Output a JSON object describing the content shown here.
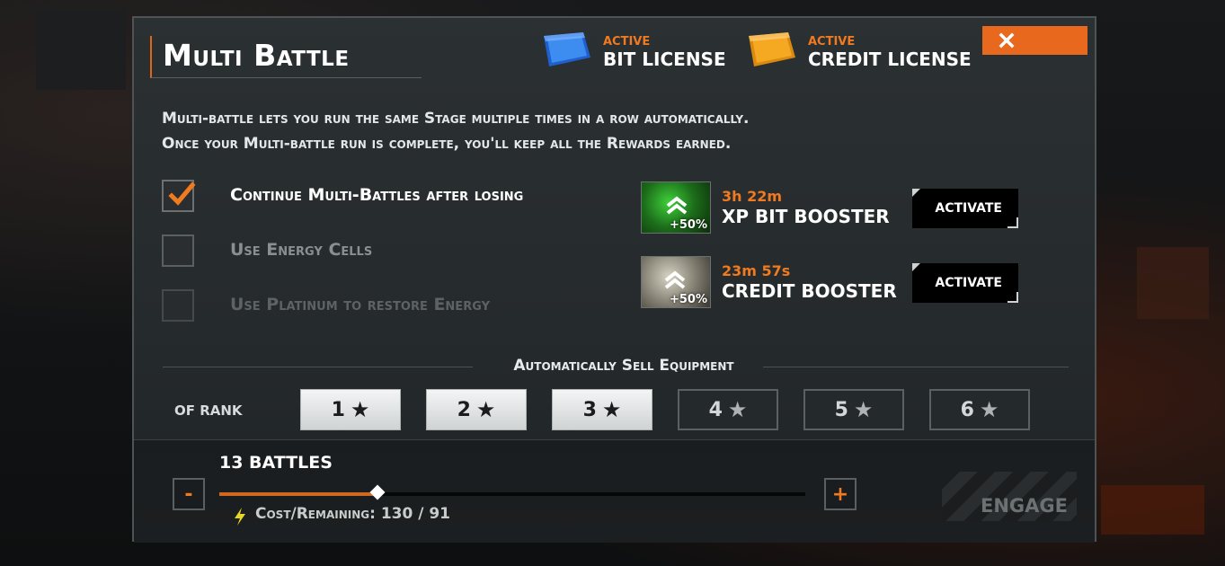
{
  "dialog": {
    "title": "Multi Battle",
    "close_icon": "close-icon"
  },
  "licenses": [
    {
      "status": "ACTIVE",
      "name": "BIT LICENSE",
      "color": "#2a7de0"
    },
    {
      "status": "ACTIVE",
      "name": "CREDIT LICENSE",
      "color": "#f0a018"
    }
  ],
  "description": {
    "line1": "Multi-battle lets you run the same Stage multiple times in a row automatically.",
    "line2": "Once your Multi-battle run is complete, you'll keep all the Rewards earned."
  },
  "options": [
    {
      "label": "Continue Multi-Battles after losing",
      "checked": true
    },
    {
      "label": "Use Energy Cells",
      "checked": false
    },
    {
      "label": "Use Platinum to restore Energy",
      "checked": false
    }
  ],
  "boosters": [
    {
      "timer": "3h 22m",
      "name": "XP BIT BOOSTER",
      "bonus": "+50%",
      "button": "ACTIVATE"
    },
    {
      "timer": "23m 57s",
      "name": "CREDIT BOOSTER",
      "bonus": "+50%",
      "button": "ACTIVATE"
    }
  ],
  "auto_sell": {
    "title": "Automatically Sell Equipment",
    "rank_label": "OF RANK",
    "ranks": [
      {
        "label": "1",
        "selected": true
      },
      {
        "label": "2",
        "selected": true
      },
      {
        "label": "3",
        "selected": true
      },
      {
        "label": "4",
        "selected": false
      },
      {
        "label": "5",
        "selected": false
      },
      {
        "label": "6",
        "selected": false
      }
    ],
    "star": "★"
  },
  "battle_count": {
    "label": "13 BATTLES",
    "minus": "-",
    "plus": "+",
    "slider_fraction": 0.27,
    "cost_text": "Cost/Remaining: 130 / 91"
  },
  "engage_button": "ENGAGE",
  "colors": {
    "accent": "#e8681e",
    "panel": "#2b3032"
  }
}
